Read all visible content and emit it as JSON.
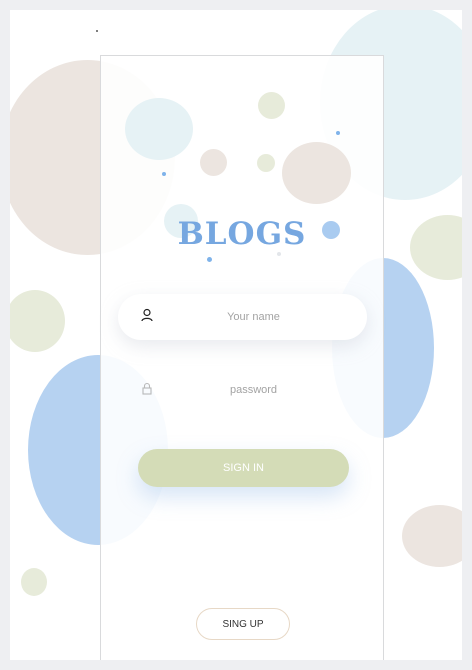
{
  "brand": {
    "title": "BLOGS"
  },
  "login_form": {
    "username_placeholder": "Your name",
    "password_placeholder": "password",
    "signin_label": "SIGN IN"
  },
  "footer": {
    "signup_label": "SING UP"
  },
  "icons": {
    "username": "user-icon",
    "password": "lock-icon"
  },
  "colors": {
    "frame": "#eeeff2",
    "brand_blue": "#76a7e0",
    "signin_green": "#d4dcb7",
    "bubble_blue": "#b6d2f1",
    "bubble_beige": "#ece5e0",
    "bubble_sage": "#e7ebda",
    "bubble_teal": "#e6f2f5"
  }
}
